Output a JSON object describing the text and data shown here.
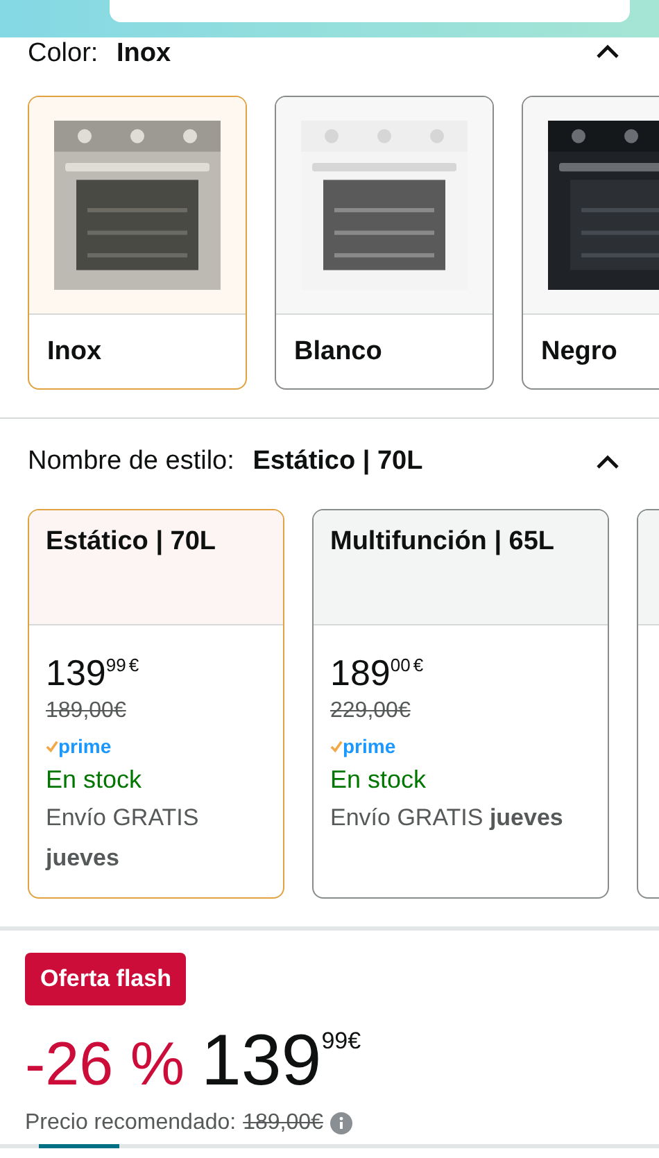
{
  "color_section": {
    "label": "Color:",
    "value": "Inox",
    "expanded": true,
    "options": [
      {
        "label": "Inox",
        "selected": true
      },
      {
        "label": "Blanco",
        "selected": false
      },
      {
        "label": "Negro",
        "selected": false
      }
    ]
  },
  "style_section": {
    "label": "Nombre de estilo:",
    "value": "Estático | 70L",
    "expanded": true,
    "options": [
      {
        "name": "Estático | 70L",
        "price_whole": "139",
        "price_fraction": "99",
        "currency": "€",
        "list_price": "189,00€",
        "prime": "prime",
        "stock": "En stock",
        "delivery": "Envío GRATIS **jueves**",
        "selected": true
      },
      {
        "name": "Multifunción | 65L",
        "price_whole": "189",
        "price_fraction": "00",
        "currency": "€",
        "list_price": "229,00€",
        "prime": "prime",
        "stock": "En stock",
        "delivery": "Envío GRATIS **jueves**",
        "selected": false
      },
      {
        "selected": false
      }
    ]
  },
  "deal": {
    "badge": "Oferta flash",
    "discount": "-26 %",
    "price_whole": "139",
    "price_fraction": "99",
    "currency": "€",
    "recommended_label": "Precio recomendado:",
    "recommended_price": "189,00€"
  }
}
